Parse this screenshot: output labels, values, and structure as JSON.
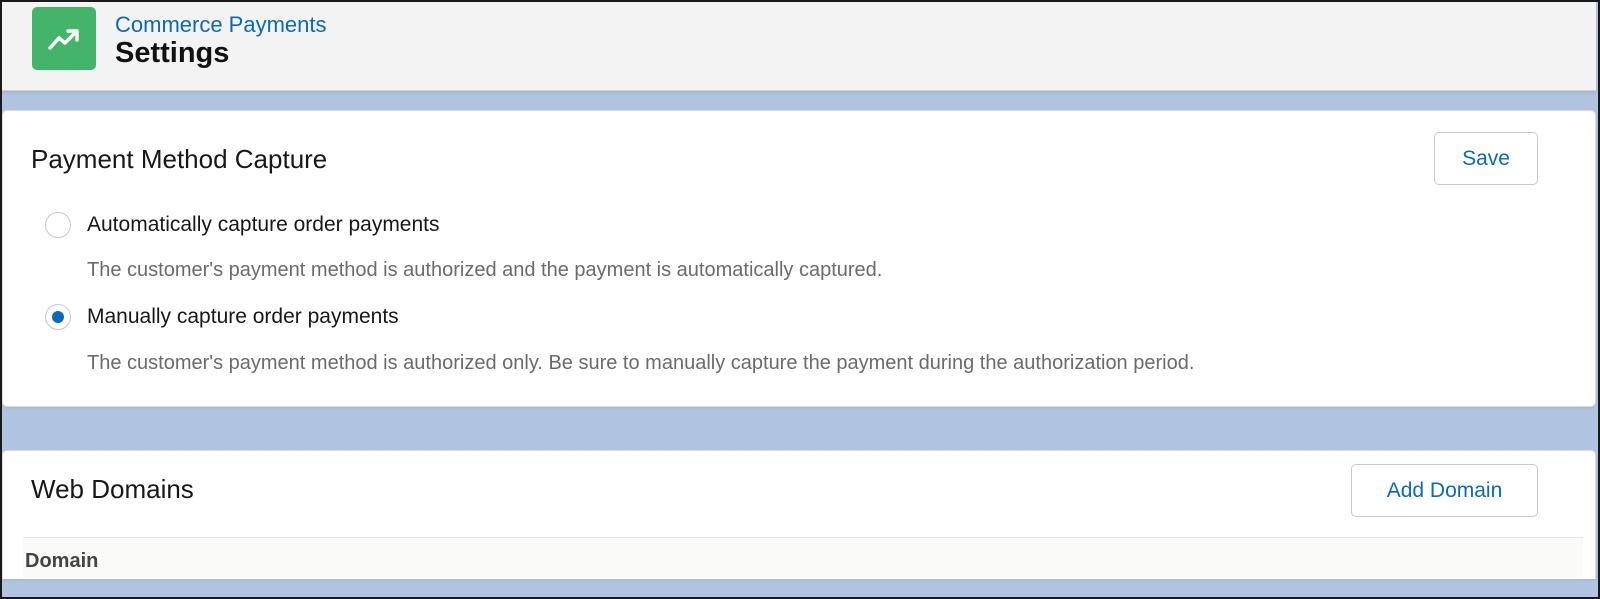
{
  "header": {
    "app_icon": "trending-chart-icon",
    "app_name": "Commerce Payments",
    "title": "Settings"
  },
  "capture_card": {
    "title": "Payment Method Capture",
    "save_label": "Save",
    "options": [
      {
        "label": "Automatically capture order payments",
        "description": "The customer's payment method is authorized and the payment is automatically captured.",
        "selected": false
      },
      {
        "label": "Manually capture order payments",
        "description": "The customer's payment method is authorized only. Be sure to manually capture the payment during the authorization period.",
        "selected": true
      }
    ]
  },
  "domains_card": {
    "title": "Web Domains",
    "add_label": "Add Domain",
    "columns": [
      "Domain"
    ]
  },
  "colors": {
    "accent": "#0b6ab8",
    "app_icon_bg": "#45b46b",
    "page_bg": "#b0c4df"
  }
}
